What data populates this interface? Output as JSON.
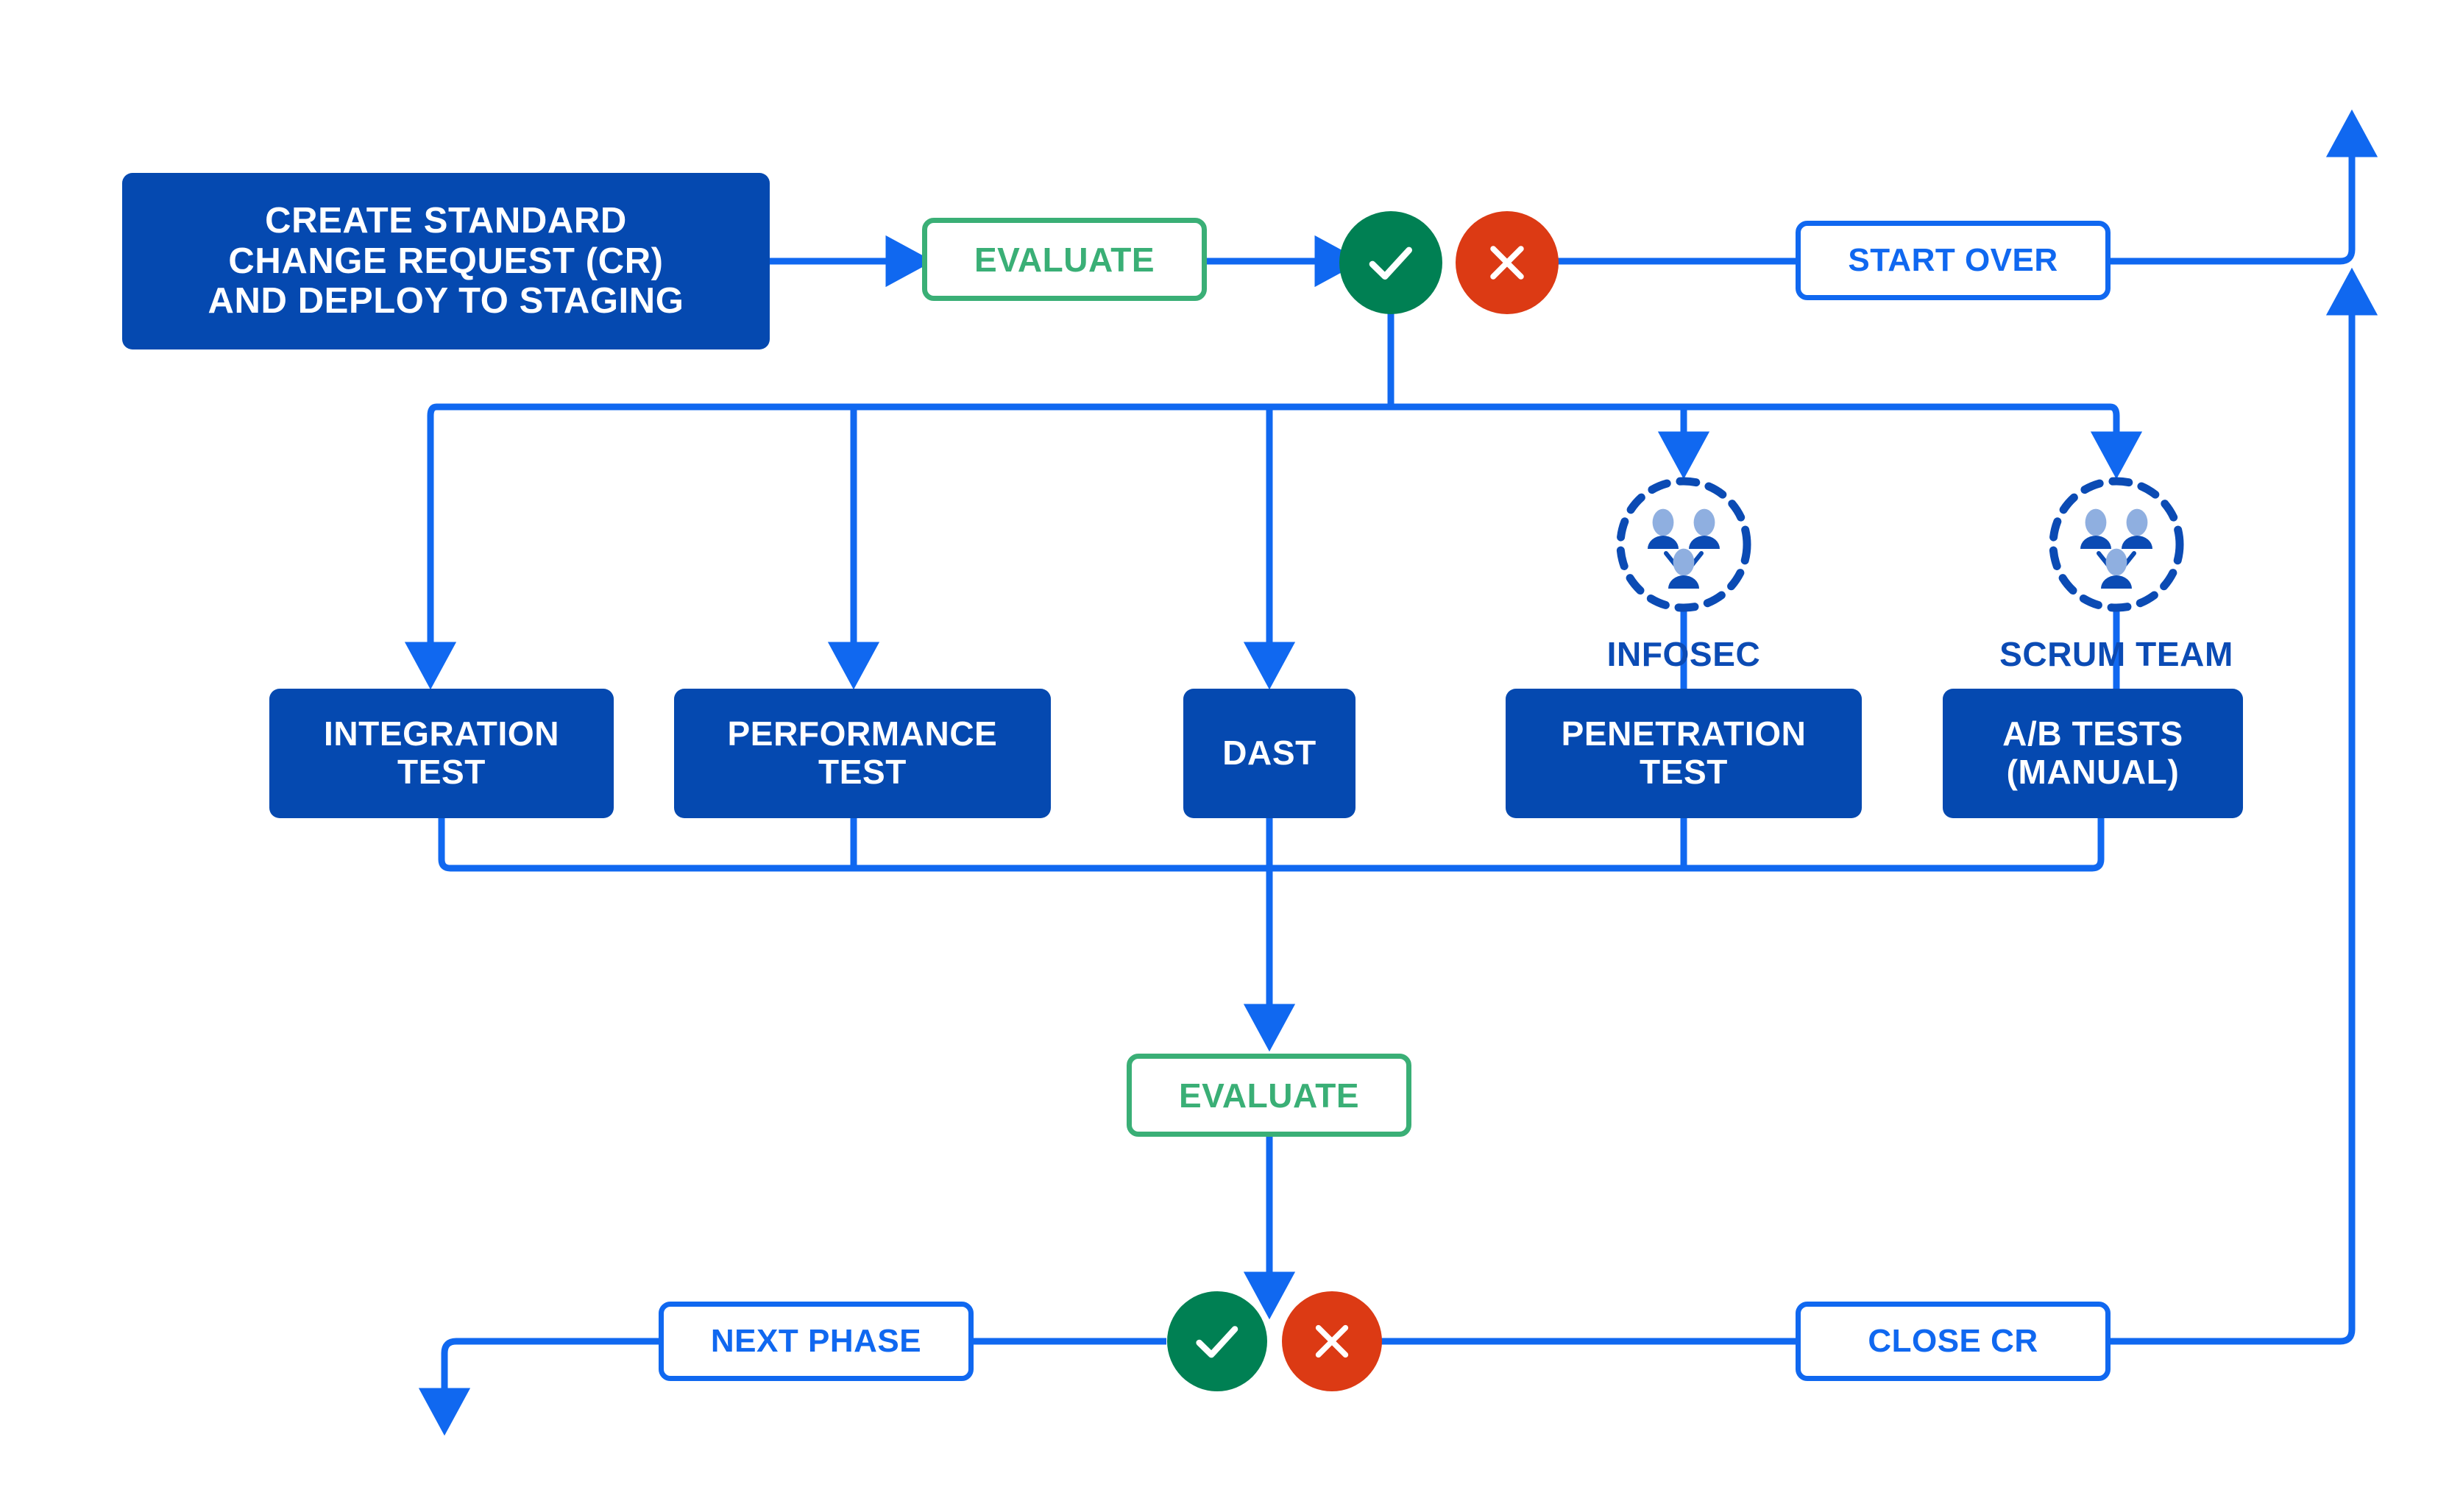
{
  "diagram": {
    "title": "Standard change request testing and approval flow",
    "colors": {
      "solid_blue": "#0549B0",
      "line_blue": "#1068F0",
      "caption_blue": "#0B4BB4",
      "green": "#3AAF76",
      "success_green": "#008053",
      "fail_red": "#DC3A14",
      "white": "#FFFFFF",
      "person_light": "#8FAFE0"
    }
  },
  "nodes": {
    "create_cr": {
      "label": "CREATE STANDARD CHANGE REQUEST (CR) AND DEPLOY TO STAGING",
      "lines": [
        "CREATE STANDARD",
        "CHANGE REQUEST (CR)",
        "AND DEPLOY TO STAGING"
      ],
      "type": "solid"
    },
    "evaluate_top": {
      "label": "EVALUATE",
      "type": "outline-green"
    },
    "start_over": {
      "label": "START OVER",
      "type": "outline-blue"
    },
    "integration_test": {
      "label": "INTEGRATION TEST",
      "lines": [
        "INTEGRATION",
        "TEST"
      ],
      "type": "solid"
    },
    "performance_test": {
      "label": "PERFORMANCE TEST",
      "lines": [
        "PERFORMANCE",
        "TEST"
      ],
      "type": "solid"
    },
    "dast": {
      "label": "DAST",
      "lines": [
        "DAST"
      ],
      "type": "solid"
    },
    "penetration_test": {
      "label": "PENETRATION TEST",
      "lines": [
        "PENETRATION",
        "TEST"
      ],
      "type": "solid"
    },
    "ab_tests": {
      "label": "A/B TESTS (MANUAL)",
      "lines": [
        "A/B TESTS",
        "(MANUAL)"
      ],
      "type": "solid"
    },
    "evaluate_bottom": {
      "label": "EVALUATE",
      "type": "outline-green"
    },
    "next_phase": {
      "label": "NEXT PHASE",
      "type": "outline-blue"
    },
    "close_cr": {
      "label": "CLOSE CR",
      "type": "outline-blue"
    }
  },
  "captions": {
    "infosec": "INFOSEC",
    "scrum_team": "SCRUM TEAM"
  },
  "status": {
    "pass_top": {
      "icon": "check-icon",
      "meaning": "pass"
    },
    "fail_top": {
      "icon": "cross-icon",
      "meaning": "fail"
    },
    "pass_bottom": {
      "icon": "check-icon",
      "meaning": "pass"
    },
    "fail_bottom": {
      "icon": "cross-icon",
      "meaning": "fail"
    }
  },
  "icons": {
    "infosec_group": "people-group-icon",
    "scrum_group": "people-group-icon"
  }
}
